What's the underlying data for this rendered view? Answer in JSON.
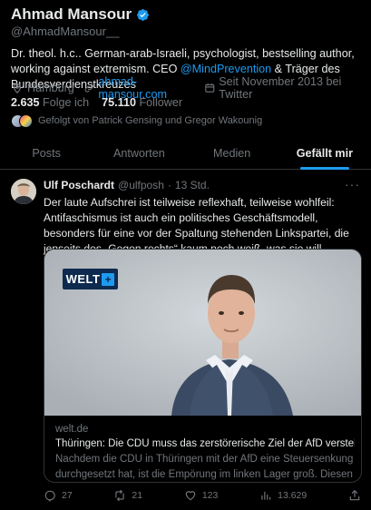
{
  "profile": {
    "name": "Ahmad Mansour",
    "handle": "@AhmadMansour__",
    "bio_part1": "Dr. theol. h.c.. German-arab-Israeli, psychologist, bestselling author, working against extremism. CEO ",
    "bio_link": "@MindPrevention",
    "bio_part2": " & Träger des Bundesverdienstkreuzes",
    "location": "Hamburg",
    "website": "ahmad-mansour.com",
    "joined": "Seit November 2013 bei Twitter",
    "following_count": "2.635",
    "following_label": "Folge ich",
    "followers_count": "75.110",
    "followers_label": "Follower",
    "followed_by": "Gefolgt von Patrick Gensing und Gregor Wakounig"
  },
  "tabs": [
    {
      "label": "Posts"
    },
    {
      "label": "Antworten"
    },
    {
      "label": "Medien"
    },
    {
      "label": "Gefällt mir"
    }
  ],
  "tweet": {
    "author": "Ulf Poschardt",
    "handle": "@ulfposh",
    "sep": "·",
    "time": "13 Std.",
    "more": "···",
    "text": "Der laute Aufschrei ist teilweise reflexhaft, teilweise wohlfeil: Antifaschismus ist auch ein politisches Geschäftsmodell, besonders für eine vor der Spaltung stehenden Linkspartei, die jenseits des „Gegen rechts“ kaum noch weiß, was sie will.",
    "card": {
      "logo": "WELT",
      "logo_plus": "+",
      "domain": "welt.de",
      "title": "Thüringen: Die CDU muss das zerstörerische Ziel der AfD verstehen - ...",
      "description": "Nachdem die CDU in Thüringen mit der AfD eine Steuersenkung durchgesetzt hat, ist die Empörung im linken Lager groß. Diesen ..."
    },
    "stats": {
      "replies": "27",
      "reposts": "21",
      "likes": "123",
      "views": "13.629"
    }
  },
  "colors": {
    "accent": "#1d9bf0",
    "muted": "#71767b",
    "text": "#e7e9ea",
    "background": "#000000"
  }
}
